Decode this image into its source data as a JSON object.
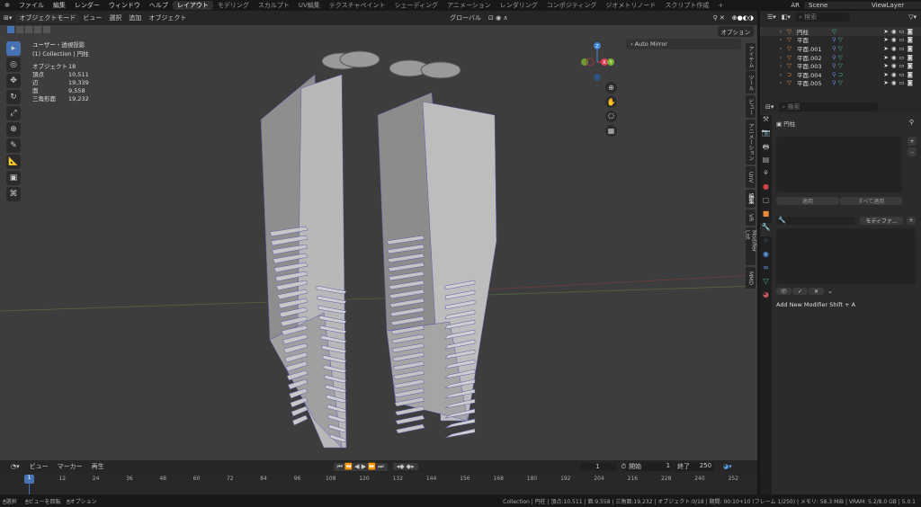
{
  "menu": {
    "items": [
      "ファイル",
      "編集",
      "レンダー",
      "ウィンドウ",
      "ヘルプ"
    ],
    "workspaces": [
      "レイアウト",
      "モデリング",
      "スカルプト",
      "UV編集",
      "テクスチャペイント",
      "シェーディング",
      "アニメーション",
      "レンダリング",
      "コンポジティング",
      "ジオメトリノード",
      "スクリプト作成"
    ],
    "active_workspace": "レイアウト",
    "add": "+",
    "engine": "AR",
    "scene": "Scene",
    "view_layer": "ViewLayer"
  },
  "header": {
    "mode": "オブジェクトモード",
    "menus": [
      "ビュー",
      "選択",
      "追加",
      "オブジェクト"
    ],
    "orientation": "グローバル",
    "options": "オプション"
  },
  "viewport": {
    "view_name": "ユーザー・透視投影",
    "collection": "(1) Collection | 円柱",
    "stats": [
      {
        "label": "オブジェクト",
        "value": "18"
      },
      {
        "label": "頂点",
        "value": "10,511"
      },
      {
        "label": "辺",
        "value": "19,339"
      },
      {
        "label": "面",
        "value": "9,558"
      },
      {
        "label": "三角形面",
        "value": "19,232"
      }
    ],
    "auto_mirror": "Auto Mirror",
    "gizmo": {
      "x": "X",
      "y": "Y",
      "z": "Z"
    },
    "ntabs": [
      "アイテム",
      "ツール",
      "ビュー",
      "アニメーション",
      "UnV",
      "編集",
      "VR",
      "Modifier List",
      "MMD"
    ]
  },
  "outliner": {
    "search_placeholder": "検索",
    "rows": [
      {
        "name": "円柱",
        "type": "mesh"
      },
      {
        "name": "平面",
        "type": "mesh"
      },
      {
        "name": "平面.001",
        "type": "mesh"
      },
      {
        "name": "平面.002",
        "type": "mesh"
      },
      {
        "name": "平面.003",
        "type": "mesh"
      },
      {
        "name": "平面.004",
        "type": "curve"
      },
      {
        "name": "平面.005",
        "type": "mesh"
      }
    ]
  },
  "properties": {
    "search_placeholder": "検索",
    "object_name": "円柱",
    "apply": "適用",
    "apply_all": "すべて適用",
    "modifier_dropdown": "モディファ...",
    "add_modifier_hint": "Add New Modifier Shift + A"
  },
  "timeline": {
    "menus": [
      "ビュー",
      "マーカー",
      "再生"
    ],
    "current_frame": "1",
    "start_label": "開始",
    "start": "1",
    "end_label": "終了",
    "end": "250",
    "ticks": [
      "1",
      "12",
      "24",
      "36",
      "48",
      "60",
      "72",
      "84",
      "96",
      "108",
      "120",
      "132",
      "144",
      "156",
      "168",
      "180",
      "192",
      "204",
      "216",
      "228",
      "240",
      "252"
    ]
  },
  "status": {
    "left": [
      "選択",
      "ビューを回転",
      "オプション"
    ],
    "right": "Collection | 円柱 | 頂点:10,511 | 面:9,558 | 三角面:19,232 | オブジェクト:0/18 | 期間: 00:10+10 (フレーム 1/250) | メモリ: 58.3 MiB | VRAM: 5.2/8.0 GB | 5.0.1"
  }
}
